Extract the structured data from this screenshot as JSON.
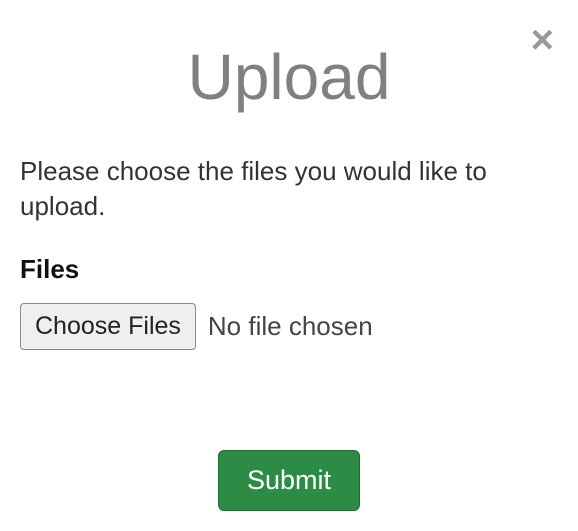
{
  "modal": {
    "title": "Upload",
    "description": "Please choose the files you would like to upload.",
    "close_icon": "×"
  },
  "form": {
    "files_label": "Files",
    "choose_button": "Choose Files",
    "file_status": "No file chosen",
    "submit": "Submit"
  }
}
